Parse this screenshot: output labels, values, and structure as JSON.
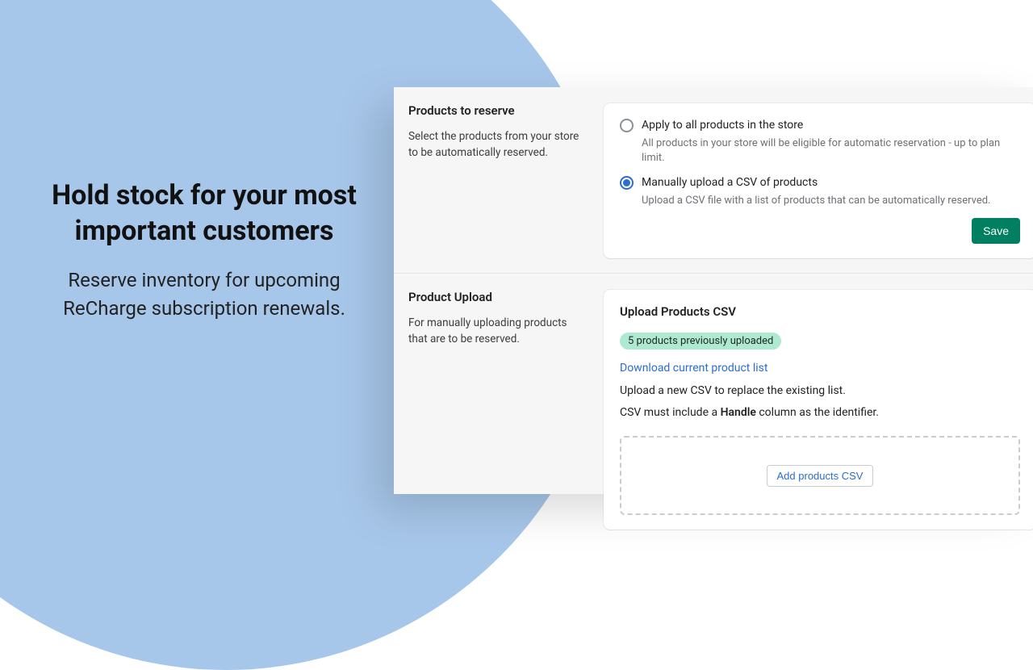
{
  "headline": {
    "title": "Hold stock for your most important customers",
    "subtitle": "Reserve inventory for upcoming ReCharge subscription renewals."
  },
  "section1": {
    "title": "Products to reserve",
    "description": "Select the products from your store to be automatically reserved.",
    "option1_label": "Apply to all products in the store",
    "option1_sub": "All products in your store will be eligible for automatic reservation - up to plan limit.",
    "option2_label": "Manually upload a CSV of products",
    "option2_sub": "Upload a CSV file with a list of products that can be automatically reserved.",
    "save_label": "Save"
  },
  "section2": {
    "title": "Product Upload",
    "description": "For manually uploading products that are to be reserved.",
    "card_title": "Upload Products CSV",
    "badge": "5 products previously uploaded",
    "download_link": "Download current product list",
    "replace_text": "Upload a new CSV to replace the existing list.",
    "handle_prefix": "CSV must include a ",
    "handle_bold": "Handle",
    "handle_suffix": " column as the identifier.",
    "add_button": "Add products CSV"
  }
}
